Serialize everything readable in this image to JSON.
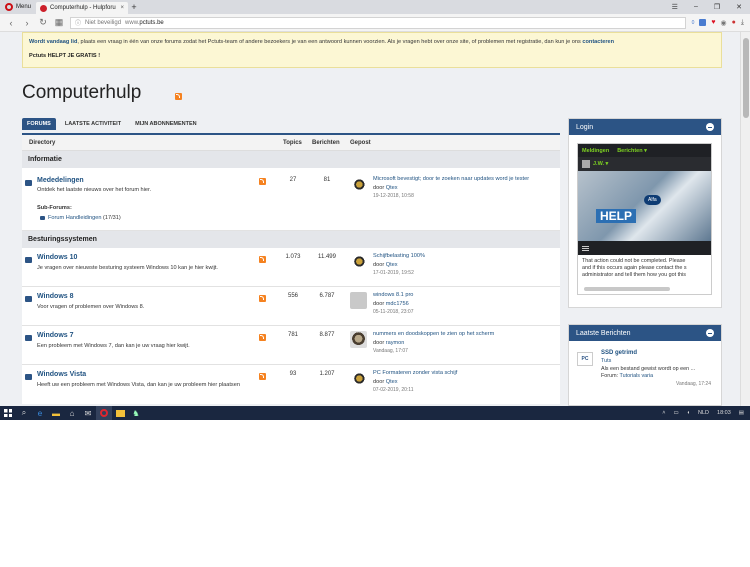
{
  "browser": {
    "menu_label": "Menu",
    "tab_title": "Computerhulp - Hulpforu",
    "tab_close": "×",
    "new_tab": "+",
    "security_label": "Niet beveiligd",
    "url_prefix": "www.",
    "url": "pctuts.be",
    "ext_count": "0"
  },
  "notice": {
    "line1_bold": "Wordt vandaag lid",
    "line1": ", plaats een vraag in één van onze forums zodat het Pctuts-team of andere bezoekers je van een antwoord kunnen voorzien. Als je vragen hebt over onze site, of problemen met registratie, dan kun je ons ",
    "link": "contacteren",
    "line2": "Pctuts HELPT JE GRATIS !"
  },
  "page_title": "Computerhulp",
  "tabs": [
    "FORUMS",
    "LAATSTE ACTIVITEIT",
    "MIJN ABONNEMENTEN"
  ],
  "columns": {
    "directory": "Directory",
    "topics": "Topics",
    "posts": "Berichten",
    "posted": "Gepost"
  },
  "categories": {
    "info": "Informatie",
    "os": "Besturingssystemen"
  },
  "forums": [
    {
      "name": "Mededelingen",
      "desc": "Ontdek het laatste nieuws over het forum hier.",
      "topics": "27",
      "posts": "81",
      "last_title": "Microsoft bevestigt; door te zoeken naar updates word je tester",
      "last_by": "door ",
      "last_user": "Qtex",
      "last_date": "19-12-2018, 10:58",
      "subforums_label": "Sub-Forums:",
      "subforum": "Forum Handleidingen",
      "subforum_count": " (17/31)"
    },
    {
      "name": "Windows 10",
      "desc": "Je vragen over nieuwste besturing systeem Windows 10 kan je hier kwijt.",
      "topics": "1.073",
      "posts": "11.499",
      "last_title": "Schijfbelasting 100%",
      "last_by": "door ",
      "last_user": "Qtex",
      "last_date": "17-01-2019, 19:52"
    },
    {
      "name": "Windows 8",
      "desc": "Voor vragen of problemen over Windows 8.",
      "topics": "556",
      "posts": "6.787",
      "last_title": "windows 8.1 pro",
      "last_by": "door ",
      "last_user": "mdc1756",
      "last_date": "05-11-2018, 23:07"
    },
    {
      "name": "Windows 7",
      "desc": "Een probleem met Windows 7, dan kan je uw vraag hier kwijt.",
      "topics": "781",
      "posts": "8.877",
      "last_title": "nummers en doodskoppen te zien op het scherm",
      "last_by": "door ",
      "last_user": "raymon",
      "last_date": "Vandaag, 17:07"
    },
    {
      "name": "Windows Vista",
      "desc": "Heeft uw een probleem met Windows Vista, dan kan je uw probleem hier plaatsen",
      "topics": "93",
      "posts": "1.207",
      "last_title": "PC Formateren zonder vista schijf",
      "last_by": "door ",
      "last_user": "Qtex",
      "last_date": "07-02-2019, 20:11"
    }
  ],
  "login": {
    "title": "Login",
    "tab_notifications": "Meldingen",
    "tab_messages": "Berichten ▾",
    "user": "J.W. ▾",
    "banner_text": "HELP",
    "banner_logo": "Alfa",
    "msg1": "That action could not be completed. Please",
    "msg2": "and if this occurs again please contact the s",
    "msg3": "administrator and tell them how you got this"
  },
  "latest": {
    "title": "Laatste Berichten",
    "logo": "PC",
    "post_title": "SSD getrimd",
    "category": "Tuts",
    "snippet": "Als een bestand gewist wordt op een ...",
    "forum_label": "Forum: ",
    "forum": "Tutorials varia",
    "date": "Vandaag, 17:24"
  },
  "taskbar": {
    "lang": "NLD",
    "time": "18:03"
  },
  "colors": {
    "accent": "#2c5485",
    "link": "#215382",
    "rss": "#f58220",
    "notice_bg": "#fcf7d4"
  }
}
